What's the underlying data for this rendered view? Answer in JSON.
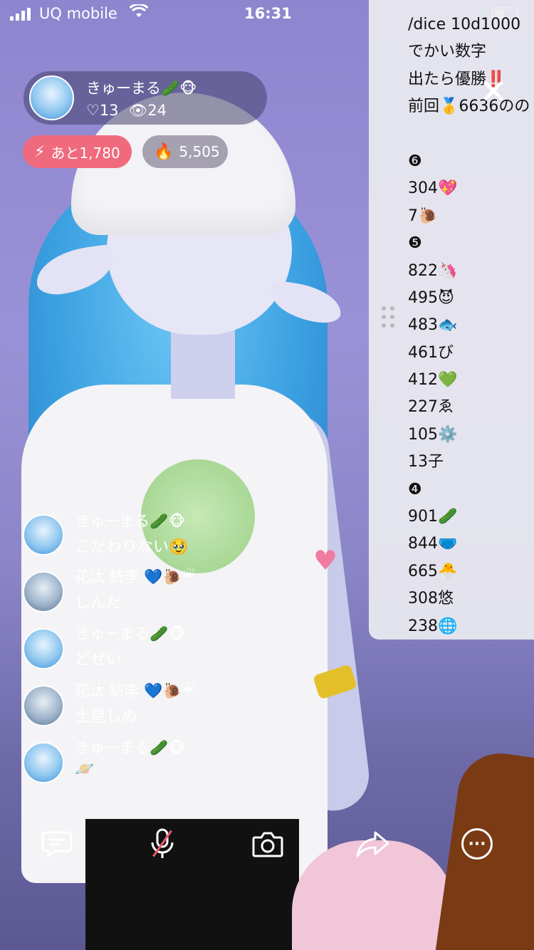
{
  "status_bar": {
    "carrier": "UQ mobile",
    "time": "16:31"
  },
  "host": {
    "name": "きゅーまる🥒🐵",
    "likes": "♡13",
    "viewers": "👁24"
  },
  "chips": {
    "goal": "あと1,780",
    "points": "5,505"
  },
  "panel": {
    "lines": [
      "/dice 10d1000",
      "でかい数字",
      "出たら優勝‼️",
      "前回🥇6636のの",
      "",
      "❻",
      "304💖",
      "7🐌",
      "❺",
      "822🦄",
      "495😈",
      "483🐟",
      "461び",
      "412💚",
      "227ゑ",
      "105⚙️",
      "13子",
      "❹",
      "901🥒",
      "844🩲",
      "665🐣",
      "308悠",
      "238🌐"
    ]
  },
  "comments": [
    {
      "name": "きゅーまる🥒🐵",
      "text": "こだわりない🥹"
    },
    {
      "name": "花汰 紡李 💙🐌☔",
      "text": "しんだ"
    },
    {
      "name": "きゅーまる🥒🐵",
      "text": "どせい"
    },
    {
      "name": "花汰 紡李 💙🐌☔",
      "text": "土星しぬ"
    },
    {
      "name": "きゅーまる🥒🐵",
      "text": "🪐"
    }
  ],
  "icons": {
    "comment": "comment-icon",
    "mic": "mic-muted-icon",
    "camera": "camera-icon",
    "share": "share-icon",
    "more": "more-icon"
  },
  "colors": {
    "goal_chip": "#f06a7d",
    "muted_slash": "#f05a6a"
  }
}
